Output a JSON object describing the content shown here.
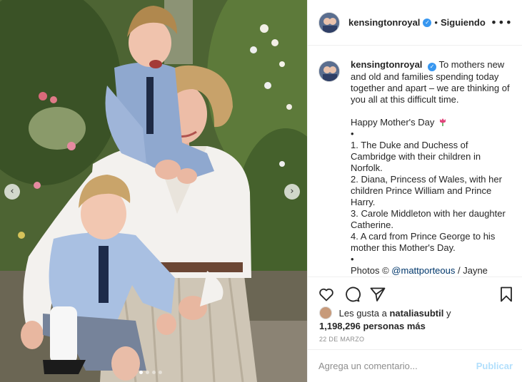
{
  "post": {
    "username": "kensingtonroyal",
    "follow_state": "Siguiendo",
    "separator": "•",
    "more_glyph": "•••",
    "verified_glyph": "✓"
  },
  "media": {
    "prev_glyph": "‹",
    "next_glyph": "›",
    "carousel_total": 4,
    "carousel_active": 1
  },
  "caption": {
    "username": "kensingtonroyal",
    "line1": "To mothers new and old and families spending today together and apart – we are thinking of you all at this difficult time.",
    "greeting": "Happy Mother's Day",
    "bullet": "•",
    "items": [
      "1. The Duke and Duchess of Cambridge with their children in Norfolk.",
      "2. Diana, Princess of Wales, with her children Prince William and Prince Harry.",
      "3. Carole Middleton with her daughter Catherine.",
      "4. A card from Prince George to his mother this Mother's Day."
    ],
    "photos_prefix": "Photos ©",
    "photos_mention": "@mattporteous",
    "photos_suffix": " / Jayne"
  },
  "likes": {
    "prefix": "Les gusta a",
    "user": "nataliasubtil",
    "connector": "y",
    "count_text": "1,198,296 personas más"
  },
  "date": "22 DE MARZO",
  "comment": {
    "placeholder": "Agrega un comentario...",
    "publish_label": "Publicar"
  },
  "icons": {
    "like": "heart-icon",
    "comment": "comment-icon",
    "share": "paper-plane-icon",
    "save": "bookmark-icon",
    "emoji_greeting": "tulip-icon"
  },
  "colors": {
    "verified": "#3897f0",
    "publish_disabled": "#b2dffc",
    "mention": "#00376b"
  }
}
